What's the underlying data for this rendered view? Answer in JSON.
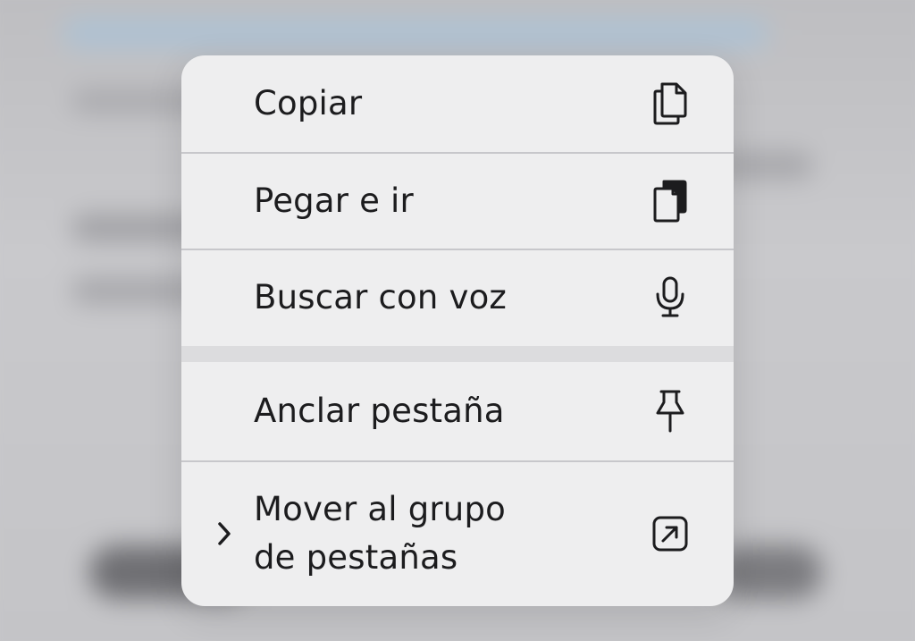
{
  "menu": {
    "items": [
      {
        "label": "Copiar",
        "icon": "copy-icon"
      },
      {
        "label": "Pegar e ir",
        "icon": "paste-go-icon"
      },
      {
        "label": "Buscar con voz",
        "icon": "microphone-icon"
      },
      {
        "label": "Anclar pestaña",
        "icon": "pin-icon"
      },
      {
        "label": "Mover al grupo\nde pestañas",
        "icon": "arrow-up-right-square-icon",
        "has_submenu": true
      }
    ]
  },
  "colors": {
    "menu_background": "#eeeeef",
    "text": "#1c1c1e",
    "divider": "#c7c7cb",
    "section_gap": "#dcdcde"
  }
}
